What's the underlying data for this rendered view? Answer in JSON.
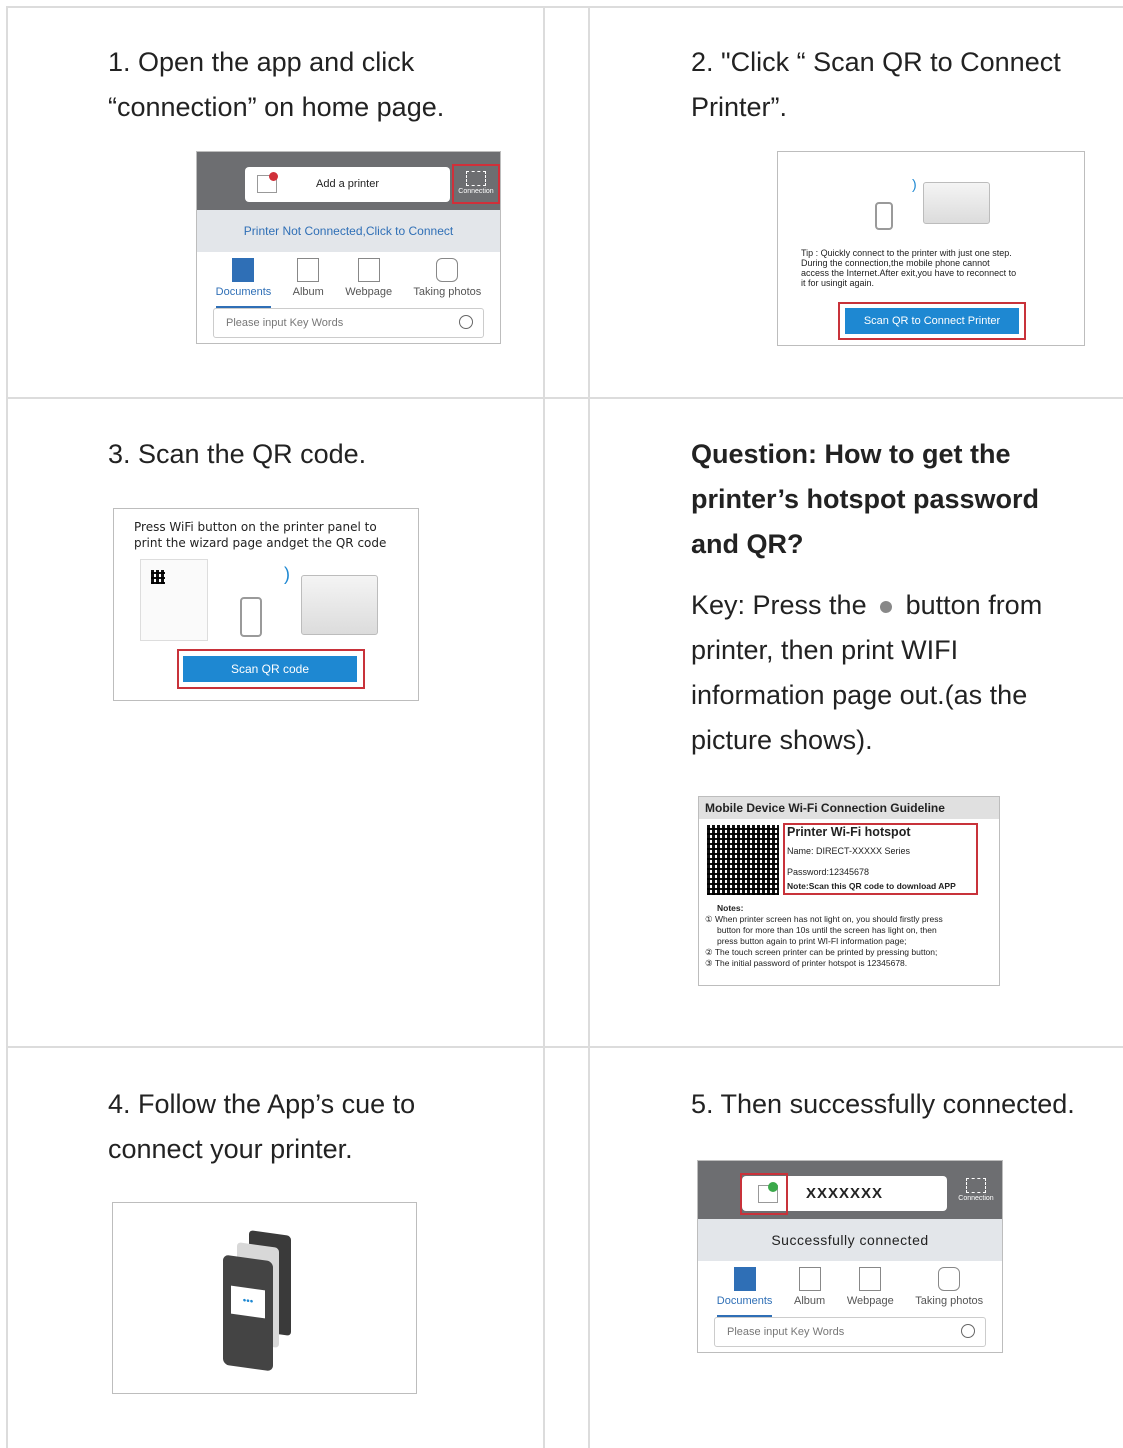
{
  "steps": {
    "s1": {
      "line1": "1. Open the app and click",
      "line2": "“connection” on home page."
    },
    "s2": {
      "line1": "2. \"Click “ Scan QR to Connect",
      "line2": "Printer”."
    },
    "s3": {
      "line1": "3. Scan the QR code."
    },
    "s4": {
      "line1": "4. Follow the App’s cue to",
      "line2": "connect your printer."
    },
    "s5": {
      "line1": "5. Then successfully connected."
    }
  },
  "question": {
    "line1": "Question: How to get the",
    "line2": "printer’s hotspot password",
    "line3": "and QR?",
    "key_a": "Key: Press the",
    "key_b": "button from",
    "key_line2": "printer, then print WIFI",
    "key_line3": "information page out.(as the",
    "key_line4": "picture shows)."
  },
  "app1": {
    "add_printer": "Add a printer",
    "connection": "Connection",
    "status": "Printer Not Connected,Click  to  Connect",
    "tabs": [
      "Documents",
      "Album",
      "Webpage",
      "Taking photos"
    ],
    "search_placeholder": "Please input Key Words"
  },
  "tip_screen": {
    "tip1": "Tip : Quickly connect to the printer with just one step.",
    "tip2": "During the connection,the mobile phone cannot",
    "tip3": "access the Internet.After exit,you have to reconnect to",
    "tip4": "it for usingit again.",
    "button": "Scan QR to Connect Printer"
  },
  "scan_screen": {
    "line1": "Press WiFi button on the printer panel to",
    "line2": "print the wizard page andget the QR code",
    "button": "Scan QR code"
  },
  "wifi_page": {
    "header": "Mobile Device Wi-Fi Connection Guideline",
    "hotspot_title": "Printer Wi-Fi hotspot",
    "name": "Name: DIRECT-XXXXX Series",
    "password": "Password:12345678",
    "note": "Note:Scan this QR code to download APP",
    "notes_title": "Notes:",
    "n1a": "① When printer screen has not light on, you should firstly press",
    "n1b": "button for more than 10s until the screen has light on, then",
    "n1c": "press      button again to print WI-FI information page;",
    "n2": "② The touch screen printer can be printed by pressing      button;",
    "n3": "③ The initial password of printer hotspot is 12345678."
  },
  "app5": {
    "printer_name": "XXXXXXX",
    "connection": "Connection",
    "status": "Successfully  connected",
    "tabs": [
      "Documents",
      "Album",
      "Webpage",
      "Taking photos"
    ],
    "search_placeholder": "Please input Key Words"
  },
  "colors": {
    "accent": "#1e88d2",
    "highlight": "#c8323a",
    "app_header": "#6d6e71"
  }
}
